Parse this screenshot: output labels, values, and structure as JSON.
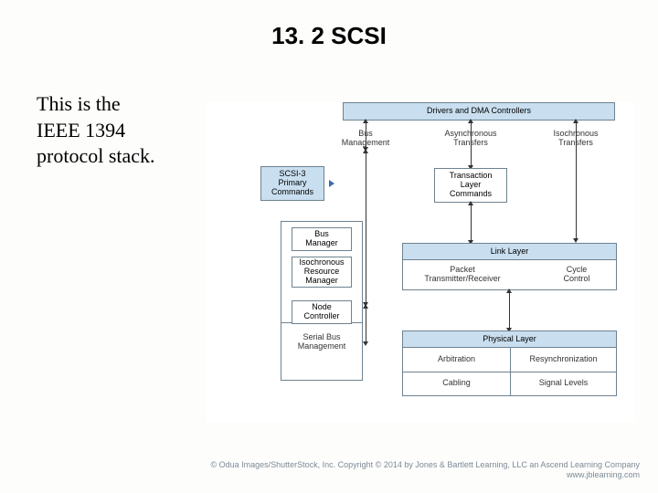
{
  "title": "13. 2 SCSI",
  "body_lines": [
    "This is the",
    "IEEE 1394",
    "protocol stack."
  ],
  "diagram": {
    "top_bar": "Drivers and DMA Controllers",
    "top_labels": {
      "bus_mgmt": "Bus\nManagement",
      "async": "Asynchronous\nTransfers",
      "iso": "Isochronous\nTransfers"
    },
    "scsi": "SCSI-3\nPrimary\nCommands",
    "transaction": "Transaction\nLayer\nCommands",
    "left_stack": {
      "bus_manager": "Bus\nManager",
      "iso_rm": "Isochronous\nResource\nManager",
      "node_ctrl": "Node\nController",
      "serial_bus": "Serial Bus\nManagement"
    },
    "link_layer": "Link Layer",
    "link_subs": {
      "pkt": "Packet\nTransmitter/Receiver",
      "cycle": "Cycle\nControl"
    },
    "physical_layer": "Physical Layer",
    "phys_subs": {
      "arb": "Arbitration",
      "resync": "Resynchronization",
      "cabling": "Cabling",
      "signal": "Signal Levels"
    }
  },
  "footer": {
    "l1": "© Odua Images/ShutterStock, Inc. Copyright © 2014 by Jones & Bartlett Learning, LLC an Ascend Learning Company",
    "l2": "www.jblearning.com"
  }
}
